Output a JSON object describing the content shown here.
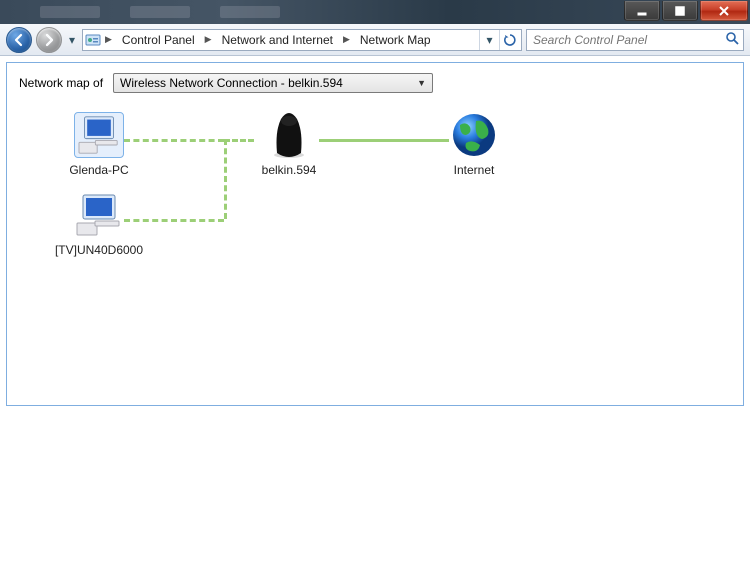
{
  "window": {
    "minimize_tip": "Minimize",
    "maximize_tip": "Maximize",
    "close_tip": "Close"
  },
  "breadcrumb": {
    "root": "Control Panel",
    "level1": "Network and Internet",
    "level2": "Network Map"
  },
  "search": {
    "placeholder": "Search Control Panel"
  },
  "map": {
    "header_label": "Network map of",
    "connection_select": "Wireless Network Connection - belkin.594",
    "nodes": {
      "this_pc": "Glenda-PC",
      "tv": "[TV]UN40D6000",
      "router": "belkin.594",
      "internet": "Internet"
    }
  }
}
